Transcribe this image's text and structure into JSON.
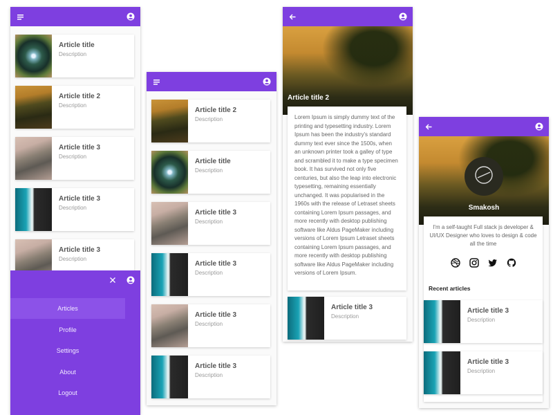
{
  "colors": {
    "primary": "#7e3fe0",
    "menu_active": "#8c52e8"
  },
  "list_screen": {
    "articles": [
      {
        "title": "Article title",
        "desc": "Description",
        "image": "forest"
      },
      {
        "title": "Article title 2",
        "desc": "Description",
        "image": "tree"
      },
      {
        "title": "Article title 3",
        "desc": "Description",
        "image": "peak"
      },
      {
        "title": "Article title 3",
        "desc": "Description",
        "image": "ocean"
      },
      {
        "title": "Article title 3",
        "desc": "Description",
        "image": "peak"
      }
    ],
    "menu": {
      "items": [
        "Articles",
        "Profile",
        "Settings",
        "About",
        "Logout"
      ],
      "active_index": 0
    }
  },
  "list_screen_2": {
    "articles": [
      {
        "title": "Article title 2",
        "desc": "Description",
        "image": "tree"
      },
      {
        "title": "Article title",
        "desc": "Description",
        "image": "forest"
      },
      {
        "title": "Article title 3",
        "desc": "Description",
        "image": "peak"
      },
      {
        "title": "Article title 3",
        "desc": "Description",
        "image": "ocean"
      },
      {
        "title": "Article title 3",
        "desc": "Description",
        "image": "peak"
      },
      {
        "title": "Article title 3",
        "desc": "Description",
        "image": "ocean"
      }
    ]
  },
  "detail_screen": {
    "hero_title": "Article title 2",
    "body": "Lorem Ipsum is simply dummy text of the printing and typesetting industry. Lorem Ipsum has been the industry's standard dummy text ever since the 1500s, when an unknown printer took a galley of type and scrambled it to make a type specimen book. It has survived not only five centuries, but also the leap into electronic typesetting, remaining essentially unchanged. It was popularised in the 1960s with the release of Letraset sheets containing Lorem Ipsum passages, and more recently with desktop publishing software like Aldus PageMaker including versions of Lorem Ipsum Letraset sheets containing Lorem Ipsum passages, and more recently with desktop publishing software like Aldus PageMaker including versions of Lorem Ipsum.",
    "related": {
      "title": "Article title 3",
      "desc": "Description",
      "image": "ocean"
    }
  },
  "profile_screen": {
    "name": "Smakosh",
    "bio": "I'm a self-taught Full stack js developer & UI/UX Designer who loves to design & code all the time",
    "social_icons": [
      "dribbble-icon",
      "instagram-icon",
      "twitter-icon",
      "github-icon"
    ],
    "recent_heading": "Recent articles",
    "recent": [
      {
        "title": "Article title 3",
        "desc": "Description",
        "image": "ocean"
      },
      {
        "title": "Article title 3",
        "desc": "Description",
        "image": "ocean"
      }
    ]
  }
}
